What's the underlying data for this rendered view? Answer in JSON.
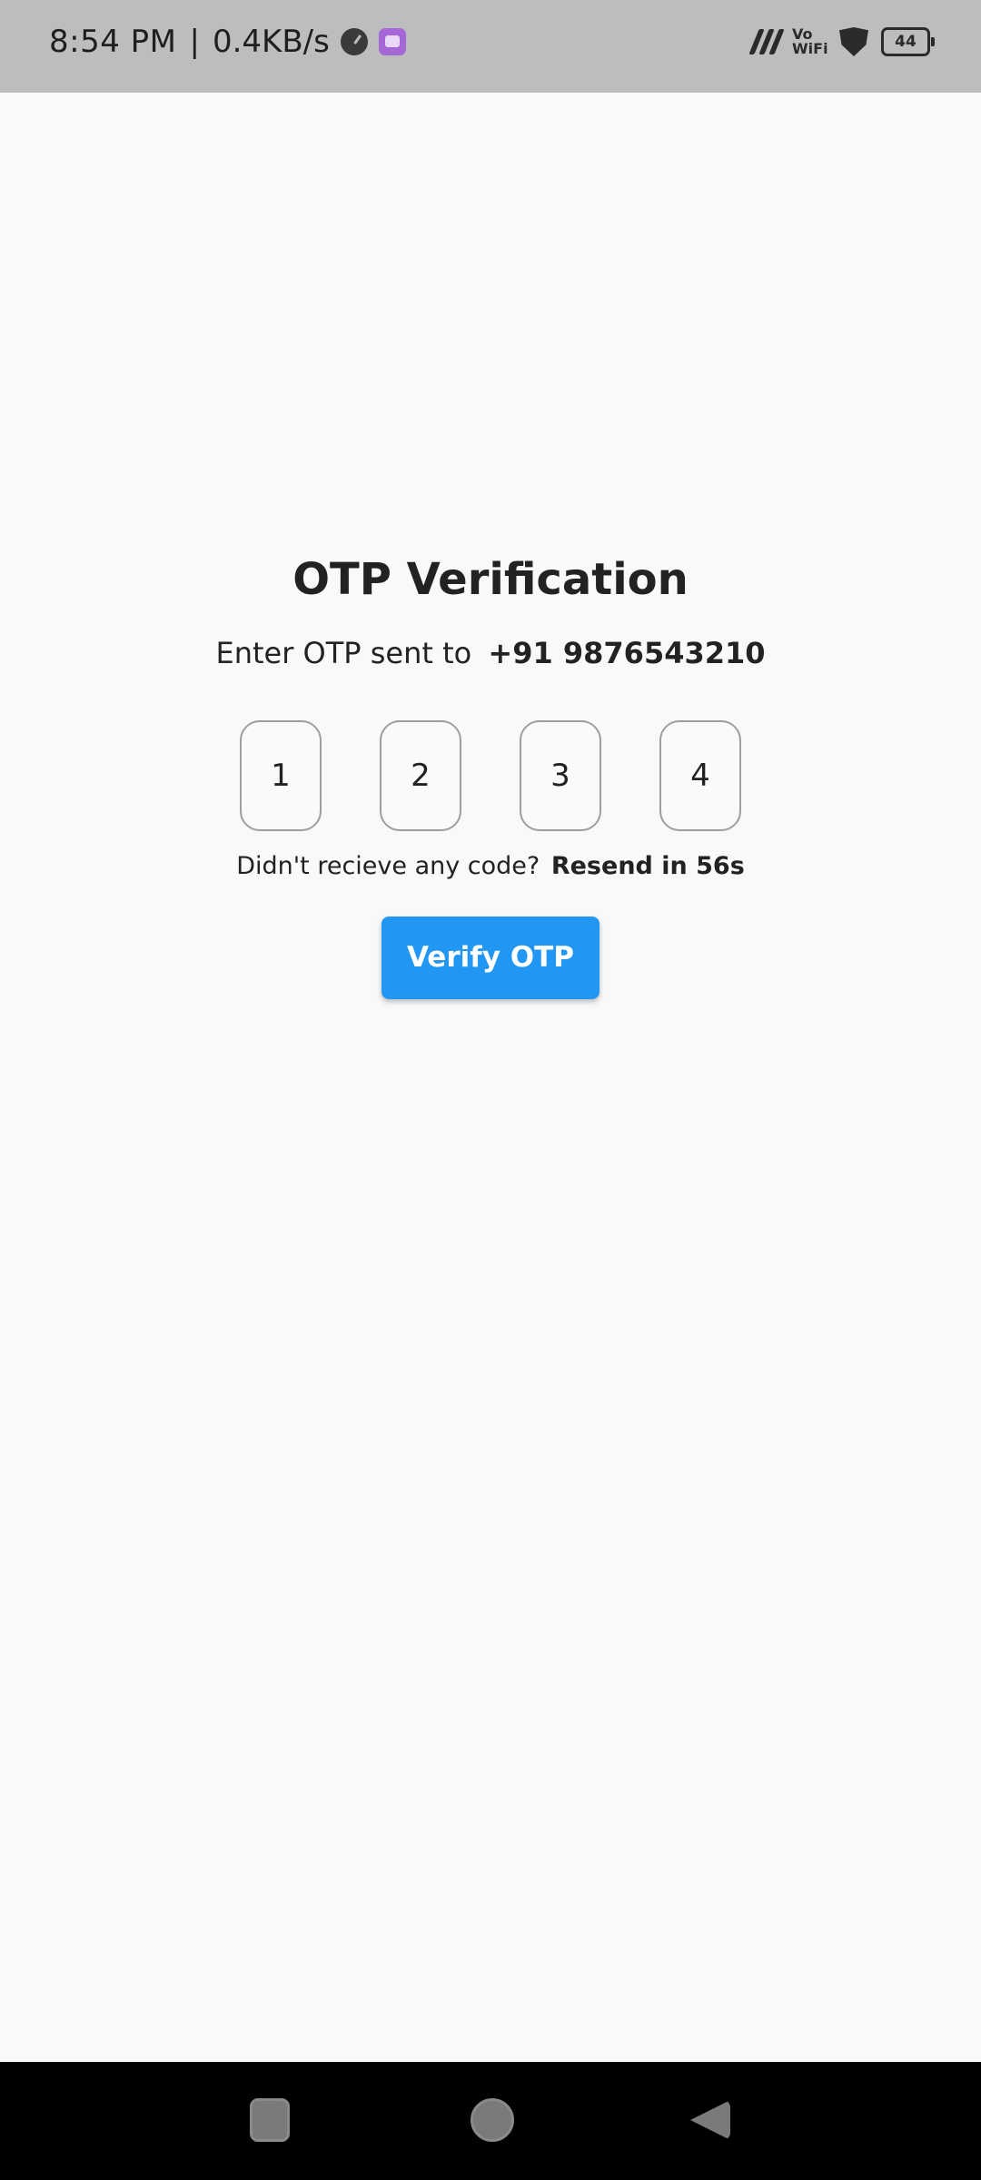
{
  "status_bar": {
    "time": "8:54 PM",
    "separator": "|",
    "net_speed": "0.4KB/s",
    "vowifi_top": "Vo",
    "vowifi_bottom": "WiFi",
    "battery": "44",
    "icons": [
      "speedometer-icon",
      "app-notification-icon",
      "signal-icon",
      "vowifi-icon",
      "shield-icon",
      "battery-icon"
    ]
  },
  "main": {
    "title": "OTP Verification",
    "subtitle_prefix": "Enter OTP sent to",
    "phone": "+91 9876543210",
    "otp_digits": [
      "1",
      "2",
      "3",
      "4"
    ],
    "resend_prefix": "Didn't recieve any code?",
    "resend_timer": "Resend in 56s",
    "verify_label": "Verify OTP"
  },
  "nav_bar": {
    "icons": [
      "recents-icon",
      "home-icon",
      "back-icon"
    ]
  },
  "colors": {
    "status_bar_bg": "#bdbdbd",
    "page_bg": "#f9f9f9",
    "accent": "#2196f3",
    "nav_bar_bg": "#000000"
  }
}
